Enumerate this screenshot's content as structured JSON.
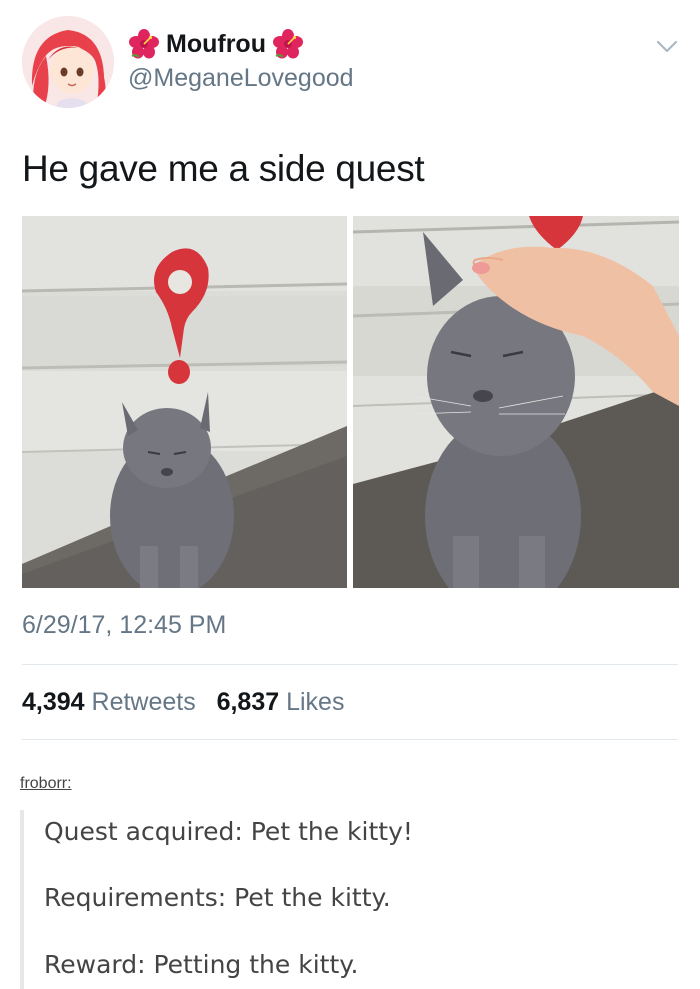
{
  "tweet": {
    "display_name": "Moufrou",
    "handle": "@MeganeLovegood",
    "text": "He gave me a side quest",
    "timestamp": "6/29/17, 12:45 PM",
    "retweets_count": "4,394",
    "retweets_label": "Retweets",
    "likes_count": "6,837",
    "likes_label": "Likes",
    "icons": {
      "name_decoration": "hibiscus-flower-icon",
      "menu": "chevron-down-icon"
    },
    "colors": {
      "secondary_text": "#657786",
      "divider": "#e1e8ed",
      "flower": "#e0245e"
    }
  },
  "reblog": {
    "username": "froborr",
    "lines": [
      "Quest acquired: Pet the kitty!",
      "Requirements: Pet the kitty.",
      "Reward: Petting the kitty."
    ]
  }
}
